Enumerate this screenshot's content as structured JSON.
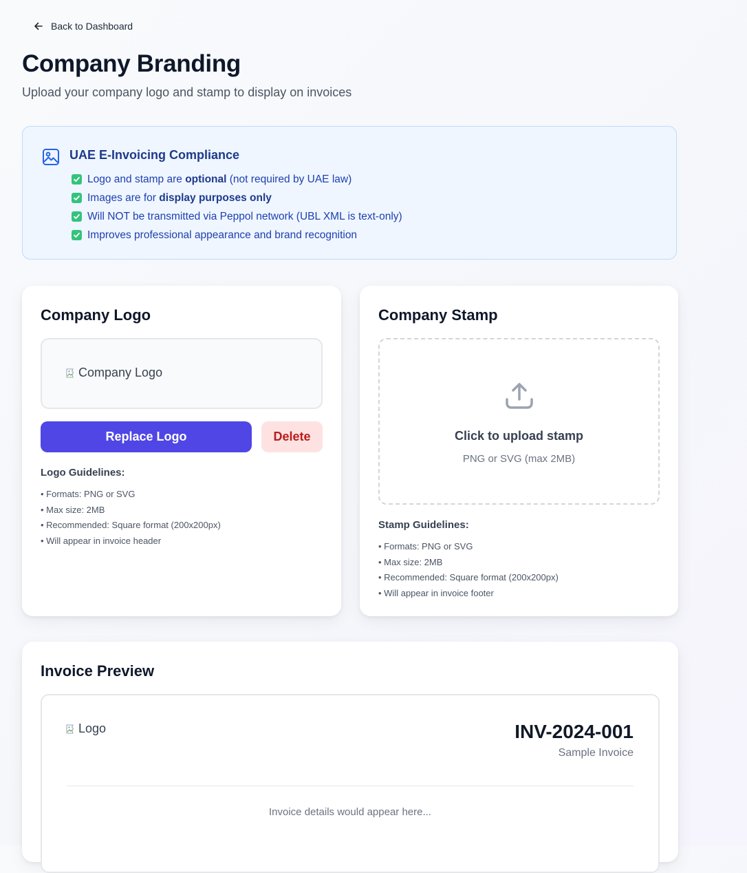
{
  "nav": {
    "back_label": "Back to Dashboard",
    "back_icon": "arrow-left-icon"
  },
  "header": {
    "title": "Company Branding",
    "subtitle": "Upload your company logo and stamp to display on invoices"
  },
  "compliance": {
    "icon": "image-icon",
    "title": "UAE E-Invoicing Compliance",
    "items": [
      {
        "pre": "Logo and stamp are ",
        "bold": "optional",
        "post": " (not required by UAE law)"
      },
      {
        "pre": "Images are for ",
        "bold": "display purposes only",
        "post": ""
      },
      {
        "pre": "Will NOT be transmitted via Peppol network (UBL XML is text-only)",
        "bold": "",
        "post": ""
      },
      {
        "pre": "Improves professional appearance and brand recognition",
        "bold": "",
        "post": ""
      }
    ],
    "colors": {
      "background": "#eff6ff",
      "border": "#bfdbfe",
      "text": "#1e40af",
      "check": "#34c37c"
    }
  },
  "logo_card": {
    "title": "Company Logo",
    "image_alt": "Company Logo",
    "replace_label": "Replace Logo",
    "delete_label": "Delete",
    "guidelines_title": "Logo Guidelines:",
    "guidelines": [
      "• Formats: PNG or SVG",
      "• Max size: 2MB",
      "• Recommended: Square format (200x200px)",
      "• Will appear in invoice header"
    ]
  },
  "stamp_card": {
    "title": "Company Stamp",
    "upload_icon": "upload-icon",
    "upload_title": "Click to upload stamp",
    "upload_hint": "PNG or SVG (max 2MB)",
    "guidelines_title": "Stamp Guidelines:",
    "guidelines": [
      "• Formats: PNG or SVG",
      "• Max size: 2MB",
      "• Recommended: Square format (200x200px)",
      "• Will appear in invoice footer"
    ]
  },
  "preview_card": {
    "title": "Invoice Preview",
    "logo_alt": "Logo",
    "invoice_number": "INV-2024-001",
    "invoice_sub": "Sample Invoice",
    "placeholder": "Invoice details would appear here..."
  },
  "colors": {
    "primary": "#4f46e5",
    "danger_bg": "#fee2e2",
    "danger_text": "#b91c1c"
  }
}
